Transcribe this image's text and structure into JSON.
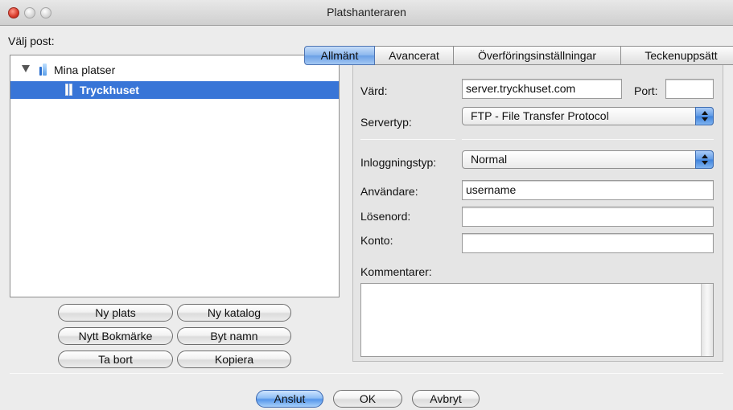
{
  "window": {
    "title": "Platshanteraren"
  },
  "left": {
    "label": "Välj post:",
    "tree": {
      "root_label": "Mina platser",
      "child_label": "Tryckhuset"
    },
    "buttons": {
      "new_site": "Ny plats",
      "new_folder": "Ny katalog",
      "new_bookmark": "Nytt Bokmärke",
      "rename": "Byt namn",
      "delete": "Ta bort",
      "copy": "Kopiera"
    }
  },
  "tabs": [
    {
      "label": "Allmänt",
      "selected": true
    },
    {
      "label": "Avancerat",
      "selected": false
    },
    {
      "label": "Överföringsinställningar",
      "selected": false
    },
    {
      "label": "Teckenuppsätt",
      "selected": false
    }
  ],
  "general": {
    "host_label": "Värd:",
    "host_value": "server.tryckhuset.com",
    "port_label": "Port:",
    "port_value": "",
    "server_type_label": "Servertyp:",
    "server_type_value": "FTP - File Transfer Protocol",
    "logon_type_label": "Inloggningstyp:",
    "logon_type_value": "Normal",
    "user_label": "Användare:",
    "user_value": "username",
    "password_label": "Lösenord:",
    "password_value": "",
    "account_label": "Konto:",
    "account_value": "",
    "comments_label": "Kommentarer:"
  },
  "footer": {
    "connect": "Anslut",
    "ok": "OK",
    "cancel": "Avbryt"
  }
}
